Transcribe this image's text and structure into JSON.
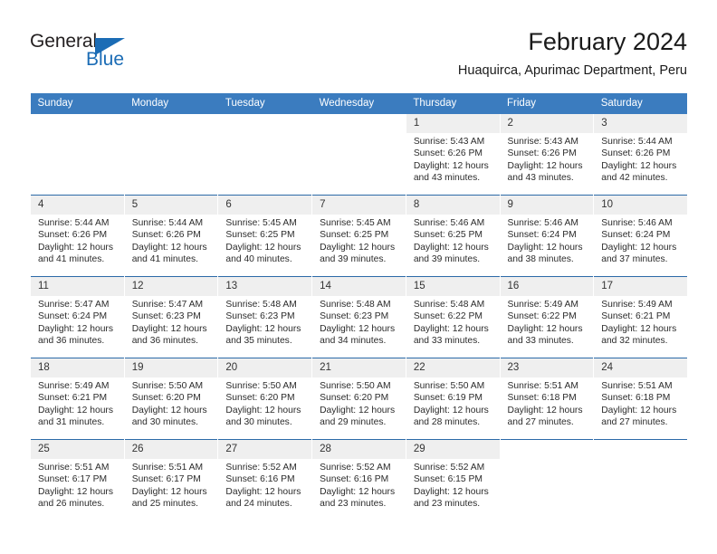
{
  "brand": {
    "name_top": "General",
    "name_bottom": "Blue",
    "triangle_color": "#1b6cb5",
    "text_color": "#231f20"
  },
  "header": {
    "month_title": "February 2024",
    "location": "Huaquirca, Apurimac Department, Peru"
  },
  "colors": {
    "header_blue": "#3b7cbf",
    "row_divider": "#2c6aa8",
    "daynum_band": "#efefef",
    "text": "#2b2b2b"
  },
  "weekdays": [
    "Sunday",
    "Monday",
    "Tuesday",
    "Wednesday",
    "Thursday",
    "Friday",
    "Saturday"
  ],
  "weeks": [
    [
      {
        "day": "",
        "blank": true,
        "sunrise": "",
        "sunset": "",
        "daylight1": "",
        "daylight2": ""
      },
      {
        "day": "",
        "blank": true,
        "sunrise": "",
        "sunset": "",
        "daylight1": "",
        "daylight2": ""
      },
      {
        "day": "",
        "blank": true,
        "sunrise": "",
        "sunset": "",
        "daylight1": "",
        "daylight2": ""
      },
      {
        "day": "",
        "blank": true,
        "sunrise": "",
        "sunset": "",
        "daylight1": "",
        "daylight2": ""
      },
      {
        "day": "1",
        "sunrise": "Sunrise: 5:43 AM",
        "sunset": "Sunset: 6:26 PM",
        "daylight1": "Daylight: 12 hours",
        "daylight2": "and 43 minutes."
      },
      {
        "day": "2",
        "sunrise": "Sunrise: 5:43 AM",
        "sunset": "Sunset: 6:26 PM",
        "daylight1": "Daylight: 12 hours",
        "daylight2": "and 43 minutes."
      },
      {
        "day": "3",
        "sunrise": "Sunrise: 5:44 AM",
        "sunset": "Sunset: 6:26 PM",
        "daylight1": "Daylight: 12 hours",
        "daylight2": "and 42 minutes."
      }
    ],
    [
      {
        "day": "4",
        "sunrise": "Sunrise: 5:44 AM",
        "sunset": "Sunset: 6:26 PM",
        "daylight1": "Daylight: 12 hours",
        "daylight2": "and 41 minutes."
      },
      {
        "day": "5",
        "sunrise": "Sunrise: 5:44 AM",
        "sunset": "Sunset: 6:26 PM",
        "daylight1": "Daylight: 12 hours",
        "daylight2": "and 41 minutes."
      },
      {
        "day": "6",
        "sunrise": "Sunrise: 5:45 AM",
        "sunset": "Sunset: 6:25 PM",
        "daylight1": "Daylight: 12 hours",
        "daylight2": "and 40 minutes."
      },
      {
        "day": "7",
        "sunrise": "Sunrise: 5:45 AM",
        "sunset": "Sunset: 6:25 PM",
        "daylight1": "Daylight: 12 hours",
        "daylight2": "and 39 minutes."
      },
      {
        "day": "8",
        "sunrise": "Sunrise: 5:46 AM",
        "sunset": "Sunset: 6:25 PM",
        "daylight1": "Daylight: 12 hours",
        "daylight2": "and 39 minutes."
      },
      {
        "day": "9",
        "sunrise": "Sunrise: 5:46 AM",
        "sunset": "Sunset: 6:24 PM",
        "daylight1": "Daylight: 12 hours",
        "daylight2": "and 38 minutes."
      },
      {
        "day": "10",
        "sunrise": "Sunrise: 5:46 AM",
        "sunset": "Sunset: 6:24 PM",
        "daylight1": "Daylight: 12 hours",
        "daylight2": "and 37 minutes."
      }
    ],
    [
      {
        "day": "11",
        "sunrise": "Sunrise: 5:47 AM",
        "sunset": "Sunset: 6:24 PM",
        "daylight1": "Daylight: 12 hours",
        "daylight2": "and 36 minutes."
      },
      {
        "day": "12",
        "sunrise": "Sunrise: 5:47 AM",
        "sunset": "Sunset: 6:23 PM",
        "daylight1": "Daylight: 12 hours",
        "daylight2": "and 36 minutes."
      },
      {
        "day": "13",
        "sunrise": "Sunrise: 5:48 AM",
        "sunset": "Sunset: 6:23 PM",
        "daylight1": "Daylight: 12 hours",
        "daylight2": "and 35 minutes."
      },
      {
        "day": "14",
        "sunrise": "Sunrise: 5:48 AM",
        "sunset": "Sunset: 6:23 PM",
        "daylight1": "Daylight: 12 hours",
        "daylight2": "and 34 minutes."
      },
      {
        "day": "15",
        "sunrise": "Sunrise: 5:48 AM",
        "sunset": "Sunset: 6:22 PM",
        "daylight1": "Daylight: 12 hours",
        "daylight2": "and 33 minutes."
      },
      {
        "day": "16",
        "sunrise": "Sunrise: 5:49 AM",
        "sunset": "Sunset: 6:22 PM",
        "daylight1": "Daylight: 12 hours",
        "daylight2": "and 33 minutes."
      },
      {
        "day": "17",
        "sunrise": "Sunrise: 5:49 AM",
        "sunset": "Sunset: 6:21 PM",
        "daylight1": "Daylight: 12 hours",
        "daylight2": "and 32 minutes."
      }
    ],
    [
      {
        "day": "18",
        "sunrise": "Sunrise: 5:49 AM",
        "sunset": "Sunset: 6:21 PM",
        "daylight1": "Daylight: 12 hours",
        "daylight2": "and 31 minutes."
      },
      {
        "day": "19",
        "sunrise": "Sunrise: 5:50 AM",
        "sunset": "Sunset: 6:20 PM",
        "daylight1": "Daylight: 12 hours",
        "daylight2": "and 30 minutes."
      },
      {
        "day": "20",
        "sunrise": "Sunrise: 5:50 AM",
        "sunset": "Sunset: 6:20 PM",
        "daylight1": "Daylight: 12 hours",
        "daylight2": "and 30 minutes."
      },
      {
        "day": "21",
        "sunrise": "Sunrise: 5:50 AM",
        "sunset": "Sunset: 6:20 PM",
        "daylight1": "Daylight: 12 hours",
        "daylight2": "and 29 minutes."
      },
      {
        "day": "22",
        "sunrise": "Sunrise: 5:50 AM",
        "sunset": "Sunset: 6:19 PM",
        "daylight1": "Daylight: 12 hours",
        "daylight2": "and 28 minutes."
      },
      {
        "day": "23",
        "sunrise": "Sunrise: 5:51 AM",
        "sunset": "Sunset: 6:18 PM",
        "daylight1": "Daylight: 12 hours",
        "daylight2": "and 27 minutes."
      },
      {
        "day": "24",
        "sunrise": "Sunrise: 5:51 AM",
        "sunset": "Sunset: 6:18 PM",
        "daylight1": "Daylight: 12 hours",
        "daylight2": "and 27 minutes."
      }
    ],
    [
      {
        "day": "25",
        "sunrise": "Sunrise: 5:51 AM",
        "sunset": "Sunset: 6:17 PM",
        "daylight1": "Daylight: 12 hours",
        "daylight2": "and 26 minutes."
      },
      {
        "day": "26",
        "sunrise": "Sunrise: 5:51 AM",
        "sunset": "Sunset: 6:17 PM",
        "daylight1": "Daylight: 12 hours",
        "daylight2": "and 25 minutes."
      },
      {
        "day": "27",
        "sunrise": "Sunrise: 5:52 AM",
        "sunset": "Sunset: 6:16 PM",
        "daylight1": "Daylight: 12 hours",
        "daylight2": "and 24 minutes."
      },
      {
        "day": "28",
        "sunrise": "Sunrise: 5:52 AM",
        "sunset": "Sunset: 6:16 PM",
        "daylight1": "Daylight: 12 hours",
        "daylight2": "and 23 minutes."
      },
      {
        "day": "29",
        "sunrise": "Sunrise: 5:52 AM",
        "sunset": "Sunset: 6:15 PM",
        "daylight1": "Daylight: 12 hours",
        "daylight2": "and 23 minutes."
      },
      {
        "day": "",
        "blank": true,
        "sunrise": "",
        "sunset": "",
        "daylight1": "",
        "daylight2": ""
      },
      {
        "day": "",
        "blank": true,
        "sunrise": "",
        "sunset": "",
        "daylight1": "",
        "daylight2": ""
      }
    ]
  ]
}
